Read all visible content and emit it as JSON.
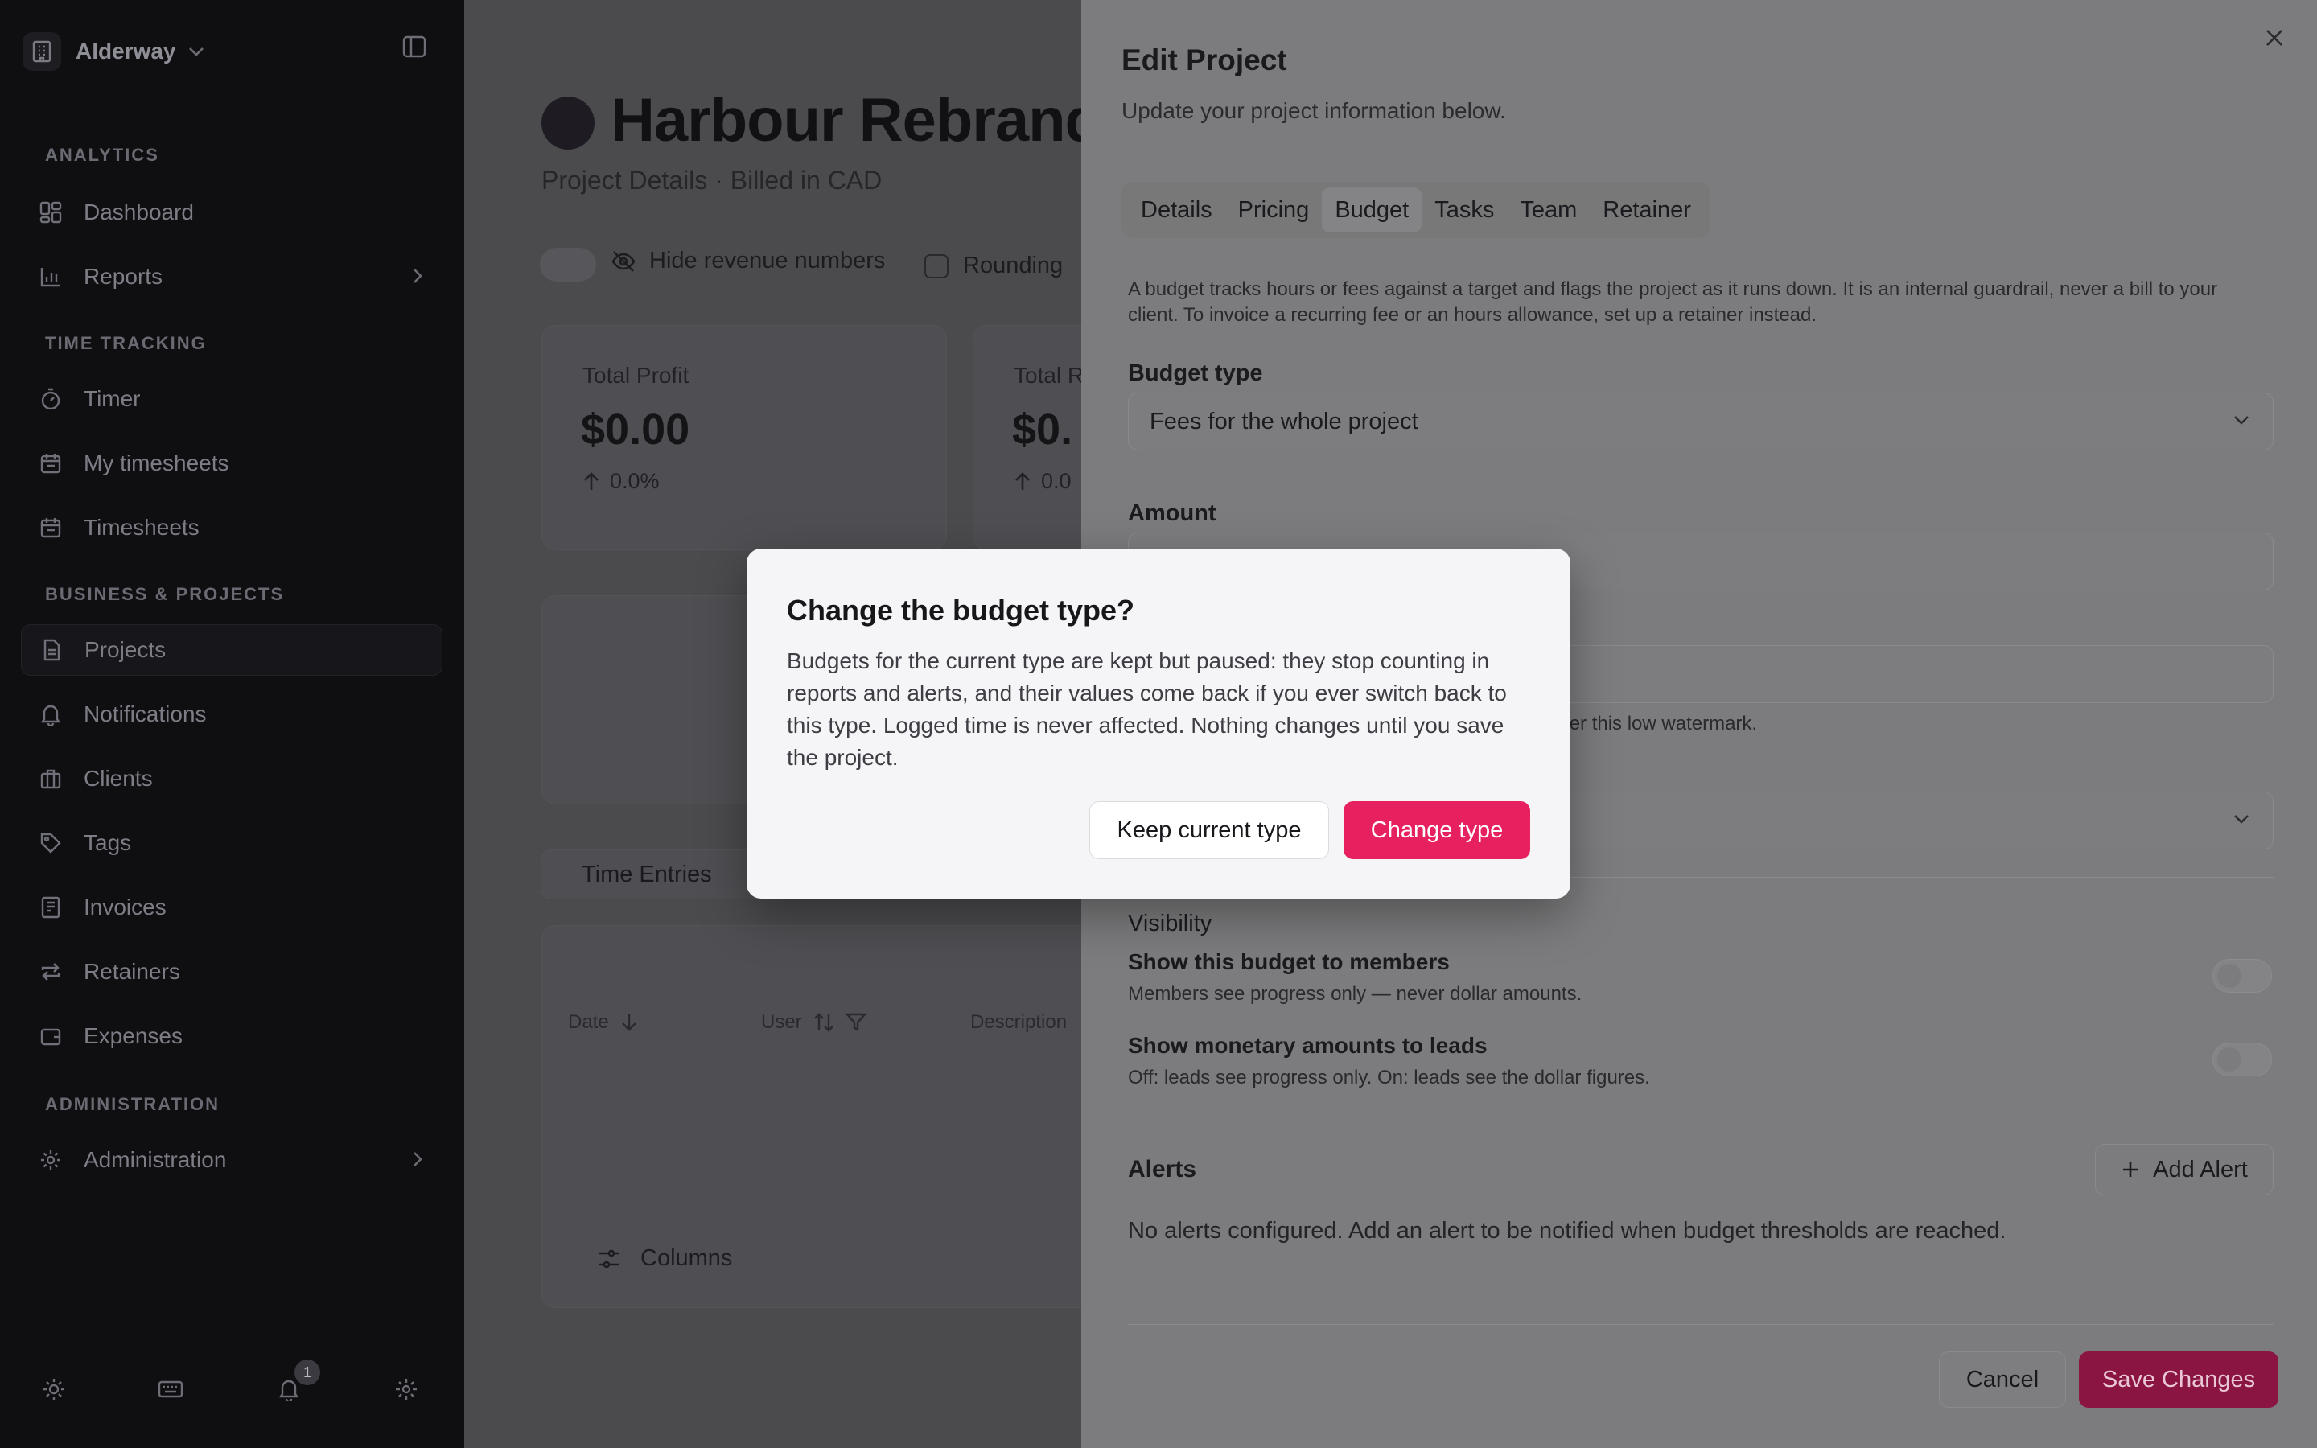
{
  "sidebar": {
    "workspace": "Alderway",
    "sections": {
      "analytics": "ANALYTICS",
      "time_tracking": "TIME TRACKING",
      "business": "BUSINESS & PROJECTS",
      "administration": "ADMINISTRATION"
    },
    "items": {
      "dashboard": "Dashboard",
      "reports": "Reports",
      "timer": "Timer",
      "my_timesheets": "My timesheets",
      "timesheets": "Timesheets",
      "projects": "Projects",
      "notifications": "Notifications",
      "clients": "Clients",
      "tags": "Tags",
      "invoices": "Invoices",
      "retainers": "Retainers",
      "expenses": "Expenses",
      "administration": "Administration"
    },
    "notification_count": "1"
  },
  "main": {
    "project_title": "Harbour Rebrand",
    "project_subtitle": "Project Details · Billed in CAD",
    "hide_revenue_label": "Hide revenue numbers",
    "rounding_label": "Rounding",
    "cards": [
      {
        "label": "Total Profit",
        "value": "$0.00",
        "change": "0.0%"
      },
      {
        "label": "Total R",
        "value": "$0.",
        "change": "0.0"
      }
    ],
    "entries_tab": "Time Entries",
    "table_headers": {
      "date": "Date",
      "user": "User",
      "description": "Description"
    },
    "columns_button": "Columns"
  },
  "edit_project": {
    "title": "Edit Project",
    "subtitle": "Update your project information below.",
    "tabs": [
      "Details",
      "Pricing",
      "Budget",
      "Tasks",
      "Team",
      "Retainer"
    ],
    "active_tab": "Budget",
    "description": "A budget tracks hours or fees against a target and flags the project as it runs down. It is an internal guardrail, never a bill to your client. To invoice a recurring fee or an hours allowance, set up a retainer instead.",
    "budget_type_label": "Budget type",
    "budget_type_value": "Fees for the whole project",
    "amount_label": "Amount",
    "watermark_hint": "nder this low watermark.",
    "visibility_title": "Visibility",
    "show_members_title": "Show this budget to members",
    "show_members_sub": "Members see progress only — never dollar amounts.",
    "show_leads_title": "Show monetary amounts to leads",
    "show_leads_sub": "Off: leads see progress only. On: leads see the dollar figures.",
    "alerts_title": "Alerts",
    "add_alert": "Add Alert",
    "no_alerts": "No alerts configured. Add an alert to be notified when budget thresholds are reached.",
    "cancel": "Cancel",
    "save": "Save Changes"
  },
  "dialog": {
    "title": "Change the budget type?",
    "body": "Budgets for the current type are kept but paused: they stop counting in reports and alerts, and their values come back if you ever switch back to this type. Logged time is never affected. Nothing changes until you save the project.",
    "keep": "Keep current type",
    "change": "Change type"
  },
  "colors": {
    "accent": "#e7205f",
    "accent_dimmed": "#8a1442",
    "sidebar_bg": "#0f0f12"
  }
}
